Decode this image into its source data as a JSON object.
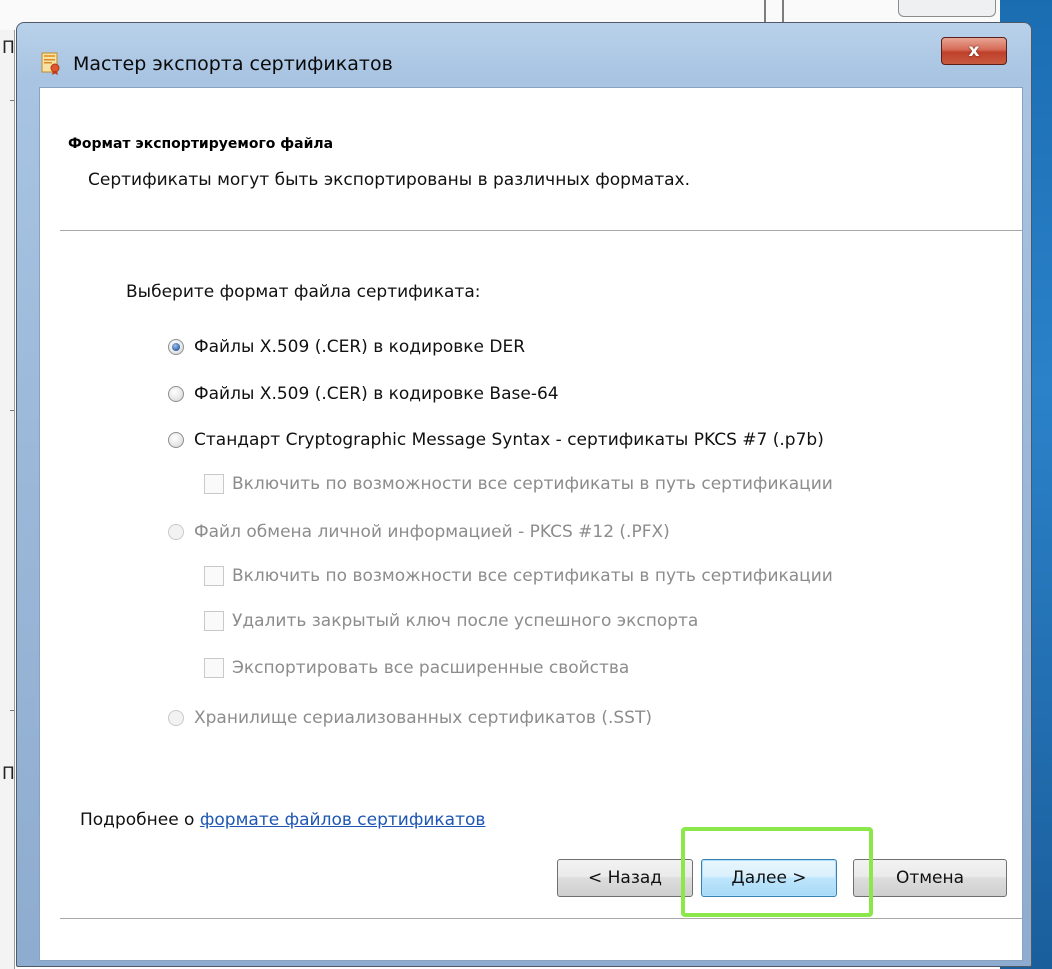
{
  "background": {
    "left_letters": [
      "П",
      "П"
    ]
  },
  "window": {
    "title": "Мастер экспорта сертификатов",
    "close_label": "x",
    "app_icon": "certificate-wizard-icon"
  },
  "header": {
    "title": "Формат экспортируемого файла",
    "subtitle": "Сертификаты могут быть экспортированы в различных форматах."
  },
  "prompt": "Выберите формат файла сертификата:",
  "options": {
    "der": {
      "label": "Файлы X.509 (.CER) в кодировке DER",
      "selected": true,
      "enabled": true
    },
    "base64": {
      "label": "Файлы X.509 (.CER) в кодировке Base-64",
      "selected": false,
      "enabled": true
    },
    "pkcs7": {
      "label": "Стандарт Cryptographic Message Syntax - сертификаты PKCS #7 (.p7b)",
      "selected": false,
      "enabled": true
    },
    "pkcs7_include_all": {
      "label": "Включить по возможности все сертификаты в путь сертификации",
      "checked": false,
      "enabled": false
    },
    "pkcs12": {
      "label": "Файл обмена личной информацией - PKCS #12 (.PFX)",
      "selected": false,
      "enabled": false
    },
    "pkcs12_include_all": {
      "label": "Включить по возможности все сертификаты в путь сертификации",
      "checked": false,
      "enabled": false
    },
    "pkcs12_delete_key": {
      "label": "Удалить закрытый ключ после успешного экспорта",
      "checked": false,
      "enabled": false
    },
    "pkcs12_export_props": {
      "label": "Экспортировать все расширенные свойства",
      "checked": false,
      "enabled": false
    },
    "sst": {
      "label": "Хранилище сериализованных сертификатов (.SST)",
      "selected": false,
      "enabled": false
    }
  },
  "more_info": {
    "prefix": "Подробнее о ",
    "link": "формате файлов сертификатов"
  },
  "buttons": {
    "back": "< Назад",
    "next": "Далее >",
    "cancel": "Отмена"
  },
  "colors": {
    "highlight": "#8ce84a",
    "link": "#1e57b3",
    "frame": "#9bb7d8"
  }
}
